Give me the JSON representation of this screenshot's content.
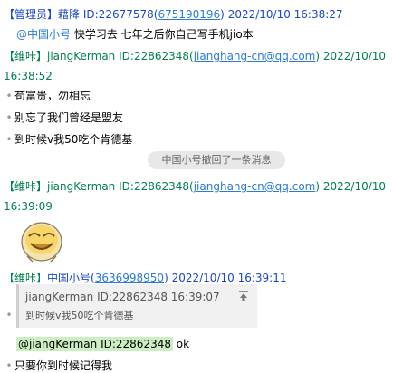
{
  "messages": [
    {
      "role": "【管理员】",
      "name": "藉降",
      "id_prefix": "ID:22677578(",
      "id_link": "675190196",
      "id_suffix": ")",
      "time": "2022/10/10 16:38:27",
      "text_mention": "@中国小号",
      "text": " 快学习去  七年之后你自己写手机jio本"
    },
    {
      "role": "【维咔】",
      "name": "jiangKerman",
      "id_prefix": "ID:22862348(",
      "id_link": "jianghang-cn@qq.com",
      "id_suffix": ")",
      "time_line1": "2022/10/10",
      "time_line2": "16:38:52",
      "bullets": [
        "苟富贵，勿相忘",
        "别忘了我们曾经是盟友",
        "到时候v我50吃个肯德基"
      ]
    },
    {
      "recall_text": "中国小号撤回了一条消息"
    },
    {
      "role": "【维咔】",
      "name": "jiangKerman",
      "id_prefix": "ID:22862348(",
      "id_link": "jianghang-cn@qq.com",
      "id_suffix": ")",
      "time_line1": "2022/10/10",
      "time_line2": "16:39:09",
      "emoji": "face-emoji"
    },
    {
      "role": "【维咔】",
      "name": "中国小号",
      "id_prefix": "(",
      "id_link": "3636998950",
      "id_suffix": ")",
      "time": "2022/10/10 16:39:11",
      "quote_header": "jiangKerman ID:22862348    16:39:07",
      "quote_text": "到时候v我50吃个肯德基",
      "mention_hl": "@jiangKerman ID:22862348",
      "mention_rest": " ok",
      "text2": "只要你到时候记得我"
    }
  ],
  "colors": {
    "role_green": "#00804a",
    "name_blue": "#1a47c8",
    "link": "#2a7bd6"
  }
}
